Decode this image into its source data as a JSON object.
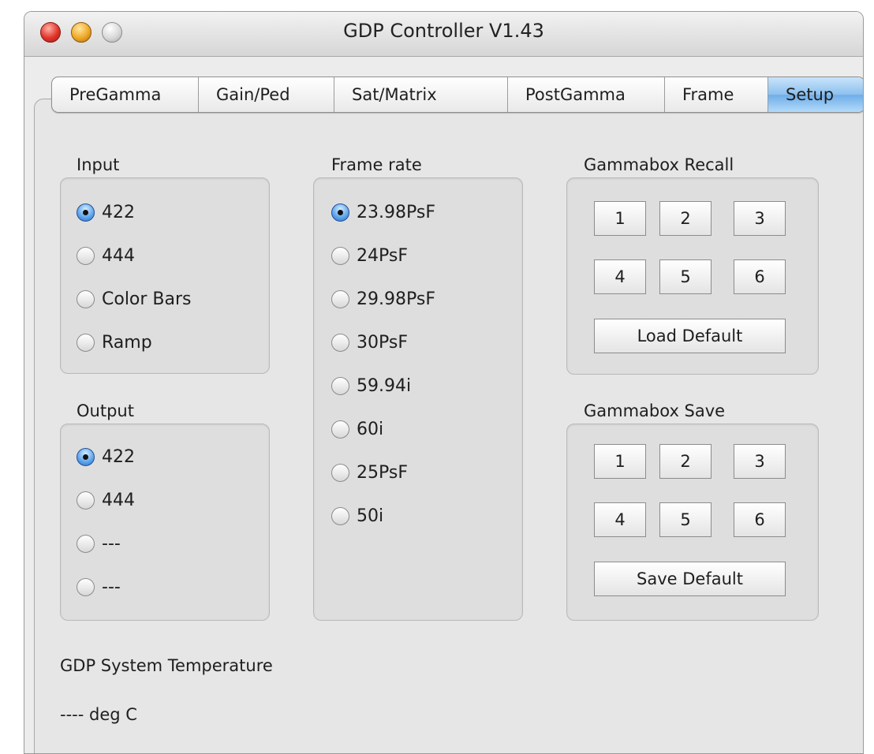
{
  "window": {
    "title": "GDP Controller V1.43"
  },
  "tabs": [
    {
      "label": "PreGamma",
      "active": false
    },
    {
      "label": "Gain/Ped",
      "active": false
    },
    {
      "label": "Sat/Matrix",
      "active": false
    },
    {
      "label": "PostGamma",
      "active": false
    },
    {
      "label": "Frame",
      "active": false
    },
    {
      "label": "Setup",
      "active": true
    }
  ],
  "input": {
    "label": "Input",
    "options": [
      {
        "label": "422",
        "selected": true
      },
      {
        "label": "444",
        "selected": false
      },
      {
        "label": "Color Bars",
        "selected": false
      },
      {
        "label": "Ramp",
        "selected": false
      }
    ]
  },
  "output": {
    "label": "Output",
    "options": [
      {
        "label": "422",
        "selected": true
      },
      {
        "label": "444",
        "selected": false
      },
      {
        "label": "---",
        "selected": false
      },
      {
        "label": "---",
        "selected": false
      }
    ]
  },
  "frame_rate": {
    "label": "Frame rate",
    "options": [
      {
        "label": "23.98PsF",
        "selected": true
      },
      {
        "label": "24PsF",
        "selected": false
      },
      {
        "label": "29.98PsF",
        "selected": false
      },
      {
        "label": "30PsF",
        "selected": false
      },
      {
        "label": "59.94i",
        "selected": false
      },
      {
        "label": "60i",
        "selected": false
      },
      {
        "label": "25PsF",
        "selected": false
      },
      {
        "label": "50i",
        "selected": false
      }
    ]
  },
  "recall": {
    "label": "Gammabox Recall",
    "buttons": [
      "1",
      "2",
      "3",
      "4",
      "5",
      "6"
    ],
    "default_label": "Load Default"
  },
  "save": {
    "label": "Gammabox Save",
    "buttons": [
      "1",
      "2",
      "3",
      "4",
      "5",
      "6"
    ],
    "default_label": "Save Default"
  },
  "temperature": {
    "label": "GDP System Temperature",
    "value": "---- deg C"
  },
  "colors": {
    "radio_selected": "#5aa3ea",
    "tab_active": "#8cc0ee"
  }
}
